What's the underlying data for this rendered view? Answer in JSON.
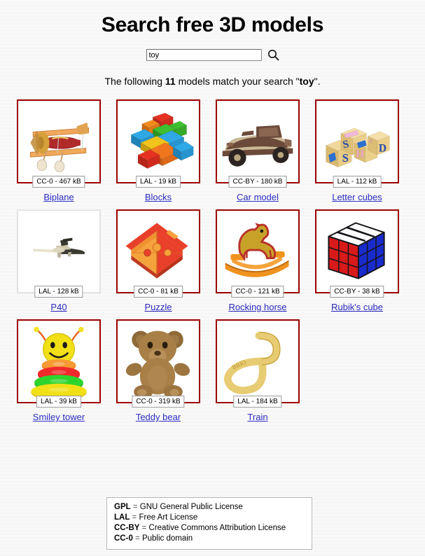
{
  "header": {
    "title": "Search free 3D models"
  },
  "search": {
    "value": "toy",
    "placeholder": "",
    "icon": "search-icon",
    "button_label": ""
  },
  "results": {
    "prefix": "The following ",
    "count": "11",
    "middle": " models match your search \"",
    "query": "toy",
    "suffix": "\"."
  },
  "models": [
    {
      "title": "Biplane",
      "license": "CC-0",
      "size": "467 kB",
      "badge": "CC-0 - 467 kB",
      "frame": "highlight",
      "art": "biplane"
    },
    {
      "title": "Blocks",
      "license": "LAL",
      "size": "19 kB",
      "badge": "LAL - 19 kB",
      "frame": "highlight",
      "art": "blocks"
    },
    {
      "title": "Car model",
      "license": "CC-BY",
      "size": "180 kB",
      "badge": "CC-BY - 180 kB",
      "frame": "highlight",
      "art": "car"
    },
    {
      "title": "Letter cubes",
      "license": "LAL",
      "size": "112 kB",
      "badge": "LAL - 112 kB",
      "frame": "highlight",
      "art": "letters"
    },
    {
      "title": "P40",
      "license": "LAL",
      "size": "128 kB",
      "badge": "LAL - 128 kB",
      "frame": "muted",
      "art": "p40"
    },
    {
      "title": "Puzzle",
      "license": "CC-0",
      "size": "81 kB",
      "badge": "CC-0 - 81 kB",
      "frame": "highlight",
      "art": "puzzle"
    },
    {
      "title": "Rocking horse",
      "license": "CC-0",
      "size": "121 kB",
      "badge": "CC-0 - 121 kB",
      "frame": "highlight",
      "art": "horse"
    },
    {
      "title": "Rubik's cube",
      "license": "CC-BY",
      "size": "38 kB",
      "badge": "CC-BY - 38 kB",
      "frame": "highlight",
      "art": "rubik"
    },
    {
      "title": "Smiley tower",
      "license": "LAL",
      "size": "39 kB",
      "badge": "LAL - 39 kB",
      "frame": "highlight",
      "art": "tower"
    },
    {
      "title": "Teddy bear",
      "license": "CC-0",
      "size": "319 kB",
      "badge": "CC-0 - 319 kB",
      "frame": "highlight",
      "art": "teddy"
    },
    {
      "title": "Train",
      "license": "LAL",
      "size": "184 kB",
      "badge": "LAL - 184 kB",
      "frame": "highlight",
      "art": "train"
    }
  ],
  "legend": [
    {
      "code": "GPL",
      "text": "GNU General Public License"
    },
    {
      "code": "LAL",
      "text": "Free Art License"
    },
    {
      "code": "CC-BY",
      "text": "Creative Commons Attribution License"
    },
    {
      "code": "CC-0",
      "text": "Public domain"
    }
  ],
  "colors": {
    "frame_highlight": "#9c0000",
    "frame_muted": "#e2e2e2",
    "link": "#2a2ac0",
    "badge_border": "#9a9a9a"
  }
}
